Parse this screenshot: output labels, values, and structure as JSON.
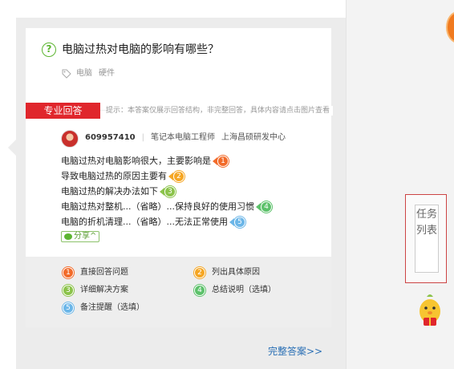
{
  "question": {
    "title": "电脑过热对电脑的影响有哪些？",
    "tags": [
      "电脑",
      "硬件"
    ]
  },
  "answer": {
    "badge": "专业回答",
    "hint": "提示：本答案仅展示回答结构，非完整回答，具体内容请点击图片查看",
    "user": {
      "id": "609957410",
      "title": "笔记本电脑工程师",
      "org": "上海昌硕研发中心"
    },
    "lines": [
      {
        "text": "电脑过热对电脑影响很大，主要影响是",
        "num": "1",
        "color": "#f26b2a"
      },
      {
        "text": "导致电脑过热的原因主要有",
        "num": "2",
        "color": "#f5a623"
      },
      {
        "text": "电脑过热的解决办法如下",
        "num": "3",
        "color": "#8bc34a"
      },
      {
        "text": "电脑过热对整机...（省略）...保持良好的使用习惯",
        "num": "4",
        "color": "#5cc16a"
      },
      {
        "text": "电脑的折机清理...（省略）...无法正常使用",
        "num": "5",
        "color": "#6bb6e8"
      }
    ],
    "share_label": "分享",
    "share_chevron": "^"
  },
  "legend": [
    {
      "num": "1",
      "label": "直接回答问题",
      "color": "#f26b2a"
    },
    {
      "num": "2",
      "label": "列出具体原因",
      "color": "#f5a623"
    },
    {
      "num": "3",
      "label": "详细解决方案",
      "color": "#8bc34a"
    },
    {
      "num": "4",
      "label": "总结说明（选填）",
      "color": "#5cc16a"
    },
    {
      "num": "5",
      "label": "备注提醒（选填）",
      "color": "#6bb6e8"
    }
  ],
  "full_answer_link": "完整答案>>",
  "task_list": "任务列表",
  "question_icon": "?",
  "icons": [
    "question-icon",
    "tag-icon",
    "wechat-icon",
    "mascot-icon"
  ],
  "accent_red": "#e0262c"
}
